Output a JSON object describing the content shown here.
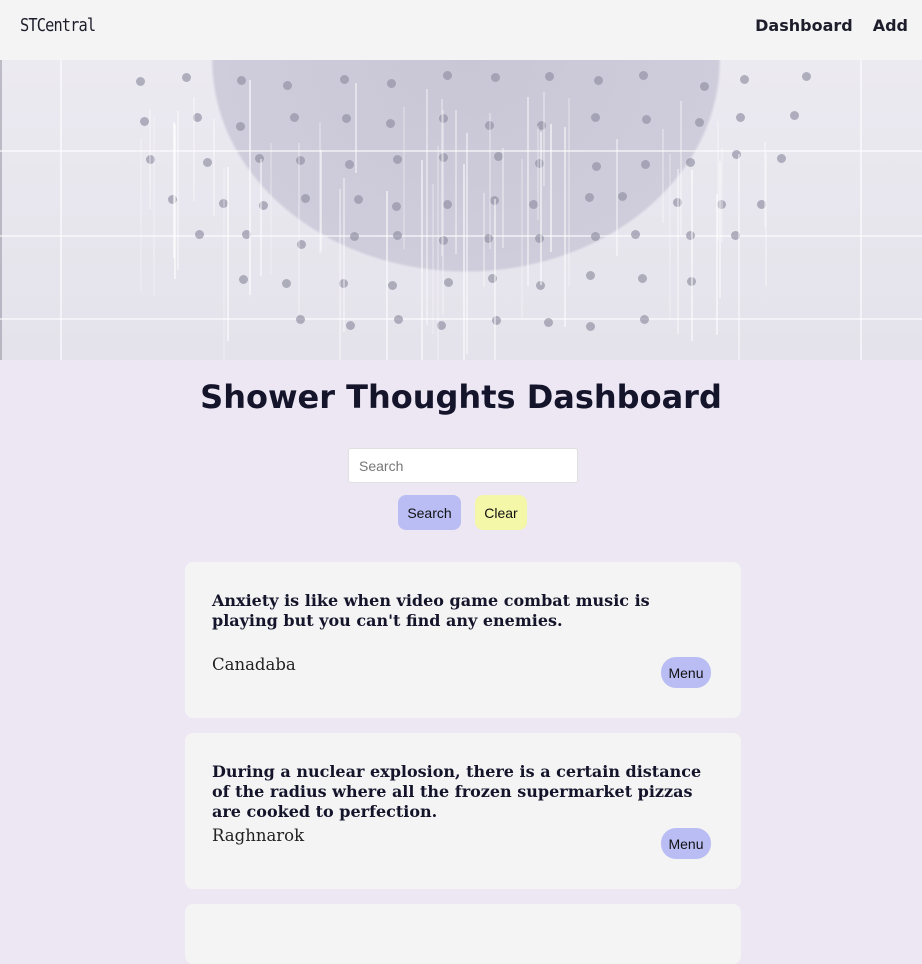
{
  "nav": {
    "brand": "STCentral",
    "links": [
      {
        "label": "Dashboard"
      },
      {
        "label": "Add"
      }
    ]
  },
  "page": {
    "title": "Shower Thoughts Dashboard"
  },
  "search": {
    "placeholder": "Search",
    "value": "",
    "search_label": "Search",
    "clear_label": "Clear"
  },
  "cards": [
    {
      "thought": "Anxiety is like when video game combat music is playing but you can't find any enemies.",
      "author": "Canadaba",
      "menu_label": "Menu"
    },
    {
      "thought": "During a nuclear explosion, there is a certain distance of the radius where all the frozen supermarket pizzas are cooked to perfection.",
      "author": "Raghnarok",
      "menu_label": "Menu"
    },
    {
      "thought": "",
      "author": "",
      "menu_label": ""
    }
  ],
  "colors": {
    "background": "#ede7f4",
    "navbar": "#f4f4f4",
    "card": "#f4f4f4",
    "search_button": "#b9bdf4",
    "clear_button": "#f4f6a8",
    "menu_button": "#b9bdf4",
    "title_text": "#14142b"
  },
  "hero_image": "shower-head-photo"
}
